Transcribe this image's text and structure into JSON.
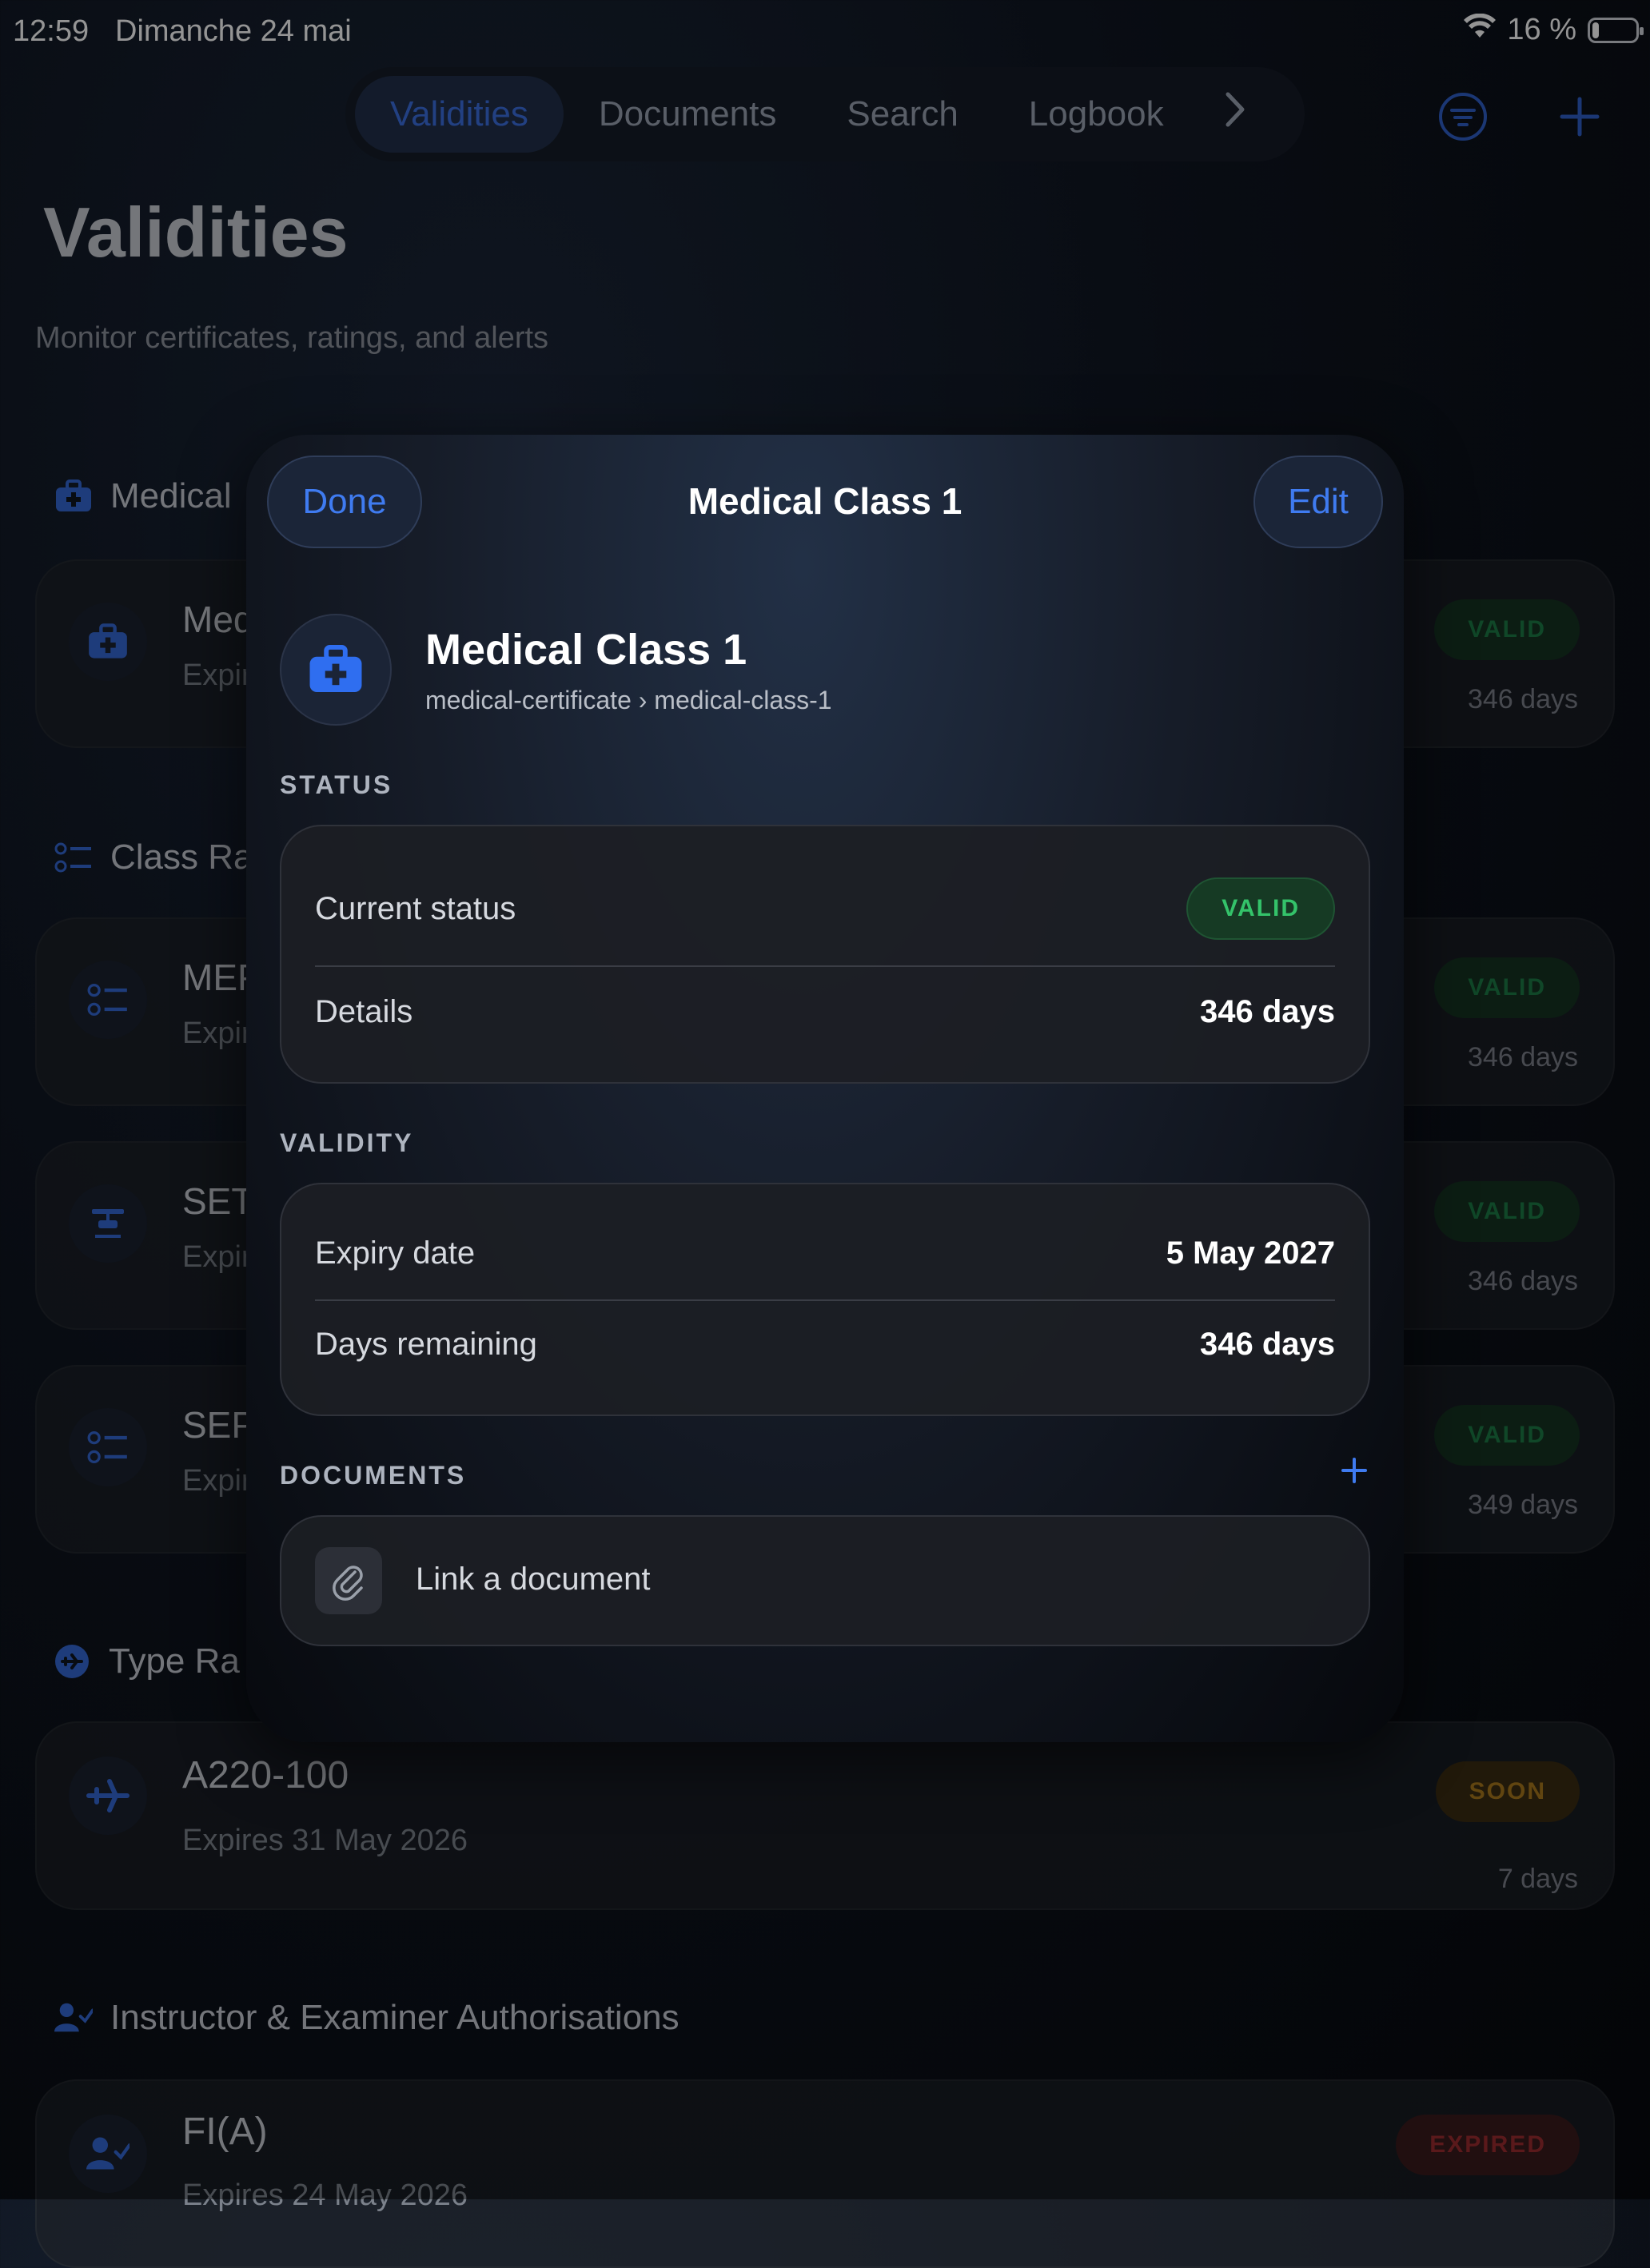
{
  "status_bar": {
    "time": "12:59",
    "date": "Dimanche 24 mai",
    "battery": "16 %",
    "battery_level": 0.16
  },
  "tabs": [
    {
      "label": "Validities",
      "active": true
    },
    {
      "label": "Documents",
      "active": false
    },
    {
      "label": "Search",
      "active": false
    },
    {
      "label": "Logbook",
      "active": false
    }
  ],
  "toolbar": {
    "more_icon": "chevron-right-icon",
    "filter_icon": "filter-circle-icon",
    "add_icon": "plus-icon"
  },
  "page": {
    "title": "Validities",
    "subtitle": "Monitor certificates, ratings, and alerts"
  },
  "sections": {
    "medical": {
      "title": "Medical",
      "icon": "medical-bag-icon"
    },
    "class_ratings": {
      "title": "Class Ra",
      "icon": "checklist-icon"
    },
    "type_ratings": {
      "title": "Type Ra",
      "icon": "airplane-circle-icon"
    },
    "instructor": {
      "title": "Instructor & Examiner Authorisations",
      "icon": "person-check-icon"
    }
  },
  "cards": [
    {
      "title": "Med",
      "subtitle": "Expir",
      "status": "VALID",
      "days": "346 days"
    },
    {
      "title": "MEP",
      "subtitle": "Expir",
      "status": "VALID",
      "days": "346 days"
    },
    {
      "title": "SET",
      "subtitle": "Expir",
      "status": "VALID",
      "days": "346 days"
    },
    {
      "title": "SEP",
      "subtitle": "Expir",
      "status": "VALID",
      "days": "349 days"
    },
    {
      "title": "A220-100",
      "subtitle": "Expires 31 May 2026",
      "status": "SOON",
      "days": "7 days"
    },
    {
      "title": "FI(A)",
      "subtitle": "Expires 24 May 2026",
      "status": "EXPIRED",
      "days": ""
    }
  ],
  "modal": {
    "done_label": "Done",
    "edit_label": "Edit",
    "title": "Medical Class 1",
    "hero_title": "Medical Class 1",
    "hero_path": "medical-certificate › medical-class-1",
    "status_section": "STATUS",
    "current_status_label": "Current status",
    "current_status_value": "VALID",
    "details_label": "Details",
    "details_value": "346 days",
    "validity_section": "VALIDITY",
    "expiry_label": "Expiry date",
    "expiry_value": "5 May 2027",
    "remaining_label": "Days remaining",
    "remaining_value": "346 days",
    "documents_section": "DOCUMENTS",
    "link_document": "Link a document"
  },
  "colors": {
    "accent": "#3f7bf0",
    "valid": "#34c36a",
    "soon": "#d89a25",
    "expired": "#c8383e"
  }
}
